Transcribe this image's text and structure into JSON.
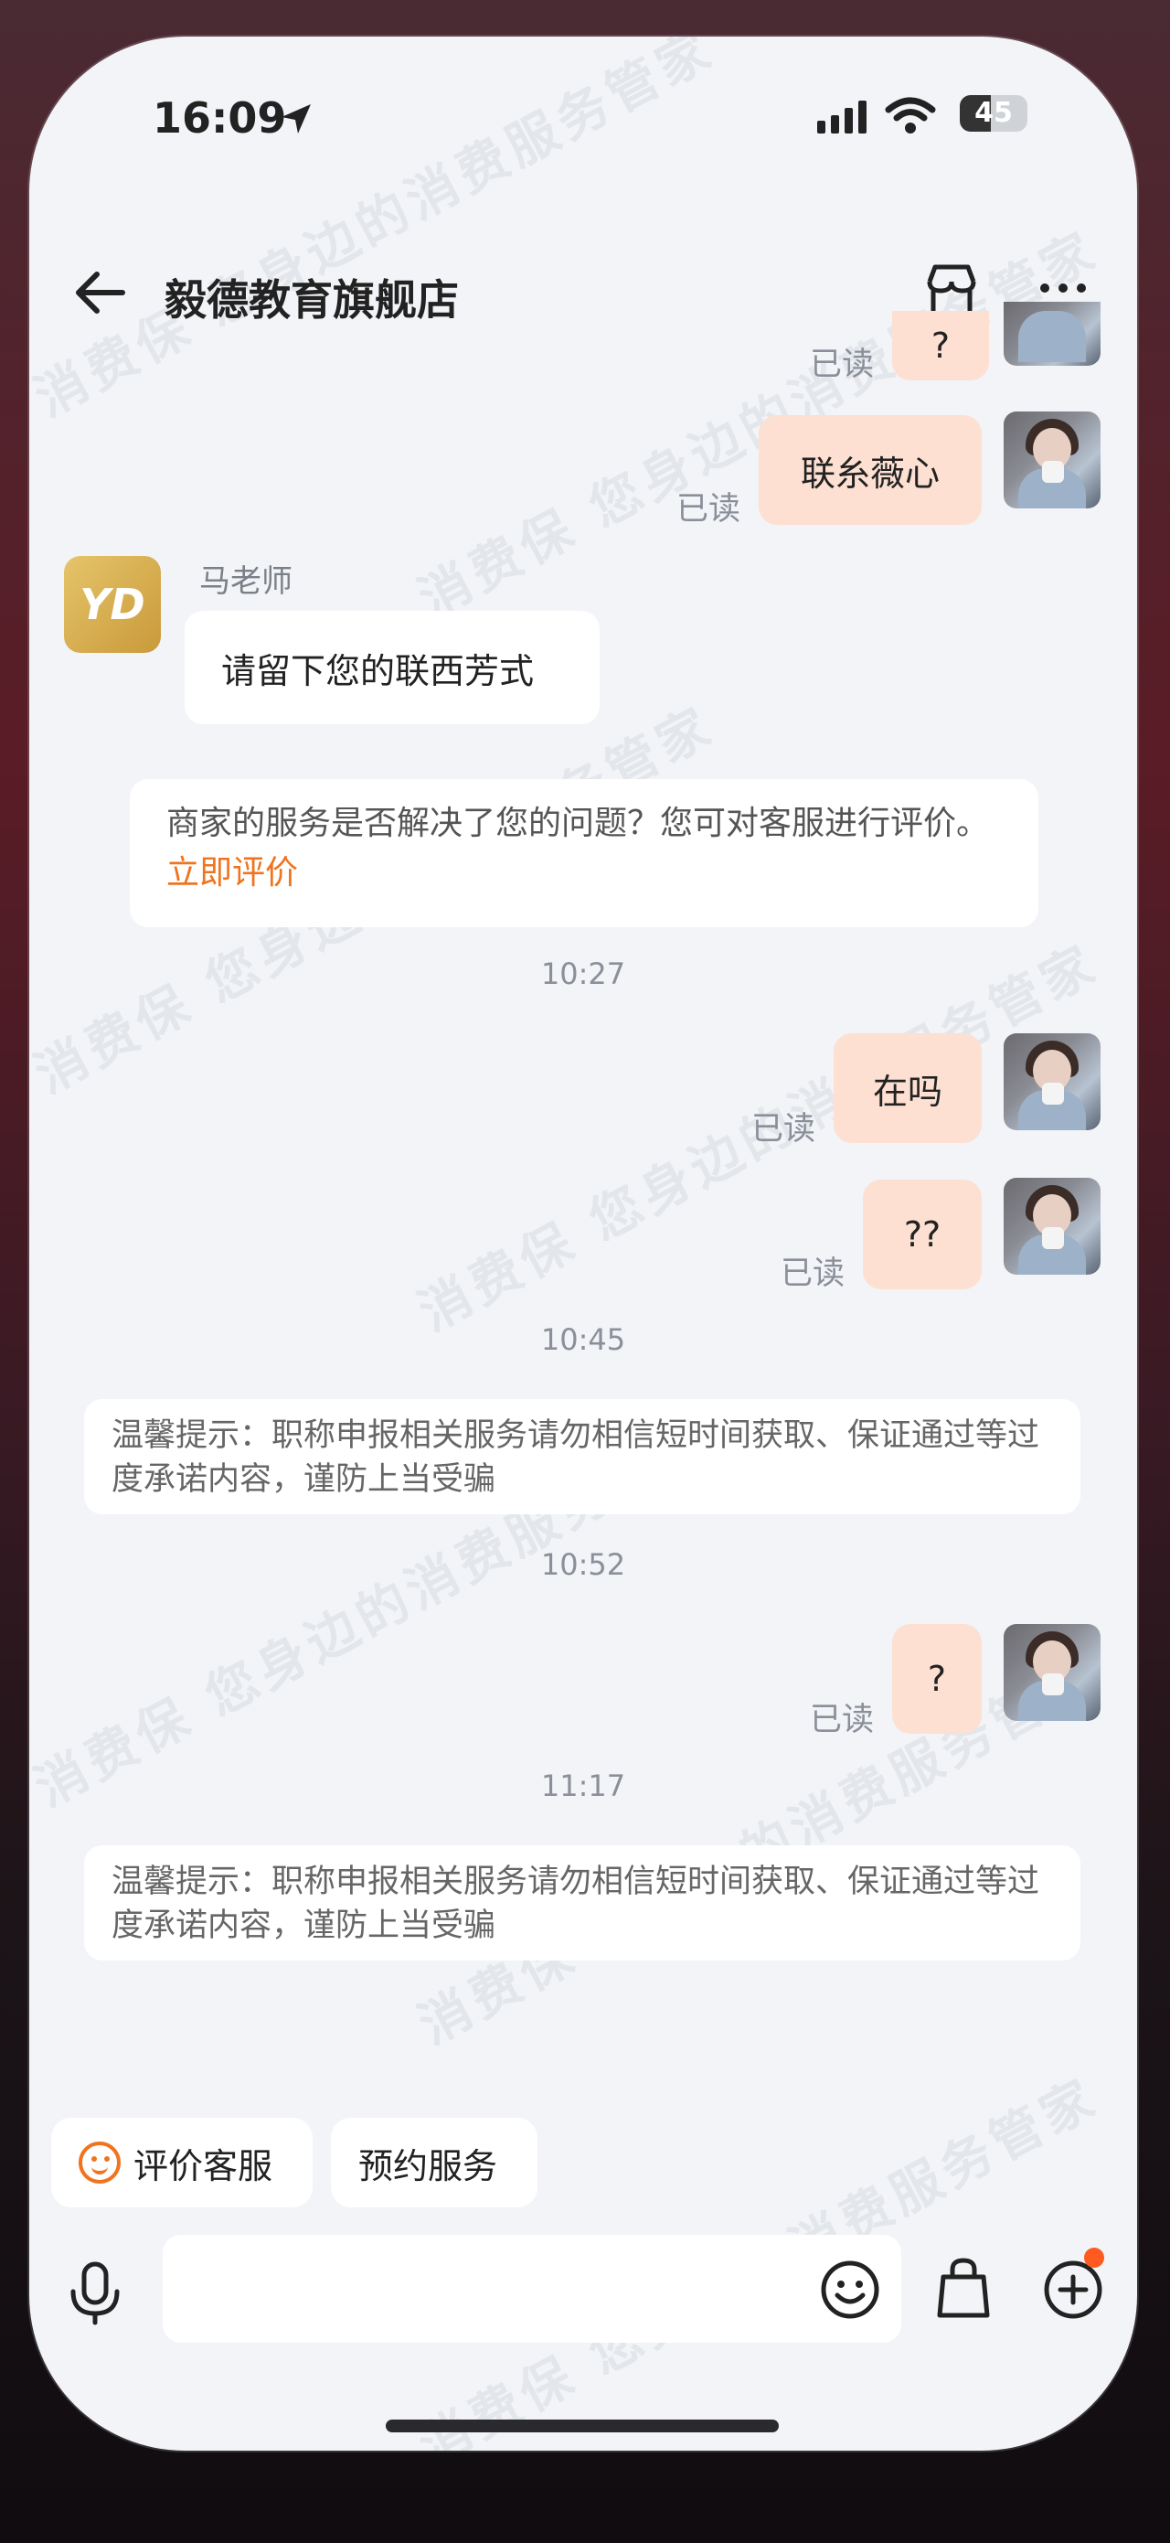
{
  "status": {
    "time": "16:09",
    "battery": "45"
  },
  "nav": {
    "title": "毅德教育旗舰店"
  },
  "messages": {
    "read_label": "已读",
    "m0_text": "?",
    "m1_text": "联糸薇心",
    "teacher_name": "马老师",
    "teacher_logo": "YD",
    "teacher_msg": "请留下您的联西芳式",
    "rating_card_text": "商家的服务是否解决了您的问题？您可对客服进行评价。",
    "rating_card_link": "立即评价",
    "ts1": "10:27",
    "m2_text": "在吗",
    "m3_text": "??",
    "ts2": "10:45",
    "tip1": "温馨提示：职称申报相关服务请勿相信短时间获取、保证通过等过度承诺内容，谨防上当受骗",
    "ts3": "10:52",
    "m4_text": "?",
    "ts4": "11:17",
    "tip2": "温馨提示：职称申报相关服务请勿相信短时间获取、保证通过等过度承诺内容，谨防上当受骗"
  },
  "quick_actions": {
    "rate": "评价客服",
    "book": "预约服务"
  },
  "watermark": "消费保 您身边的消费服务管家",
  "colors": {
    "accent": "#f0741e",
    "my_bubble": "#fde0d2",
    "background": "#f2f4f7"
  }
}
